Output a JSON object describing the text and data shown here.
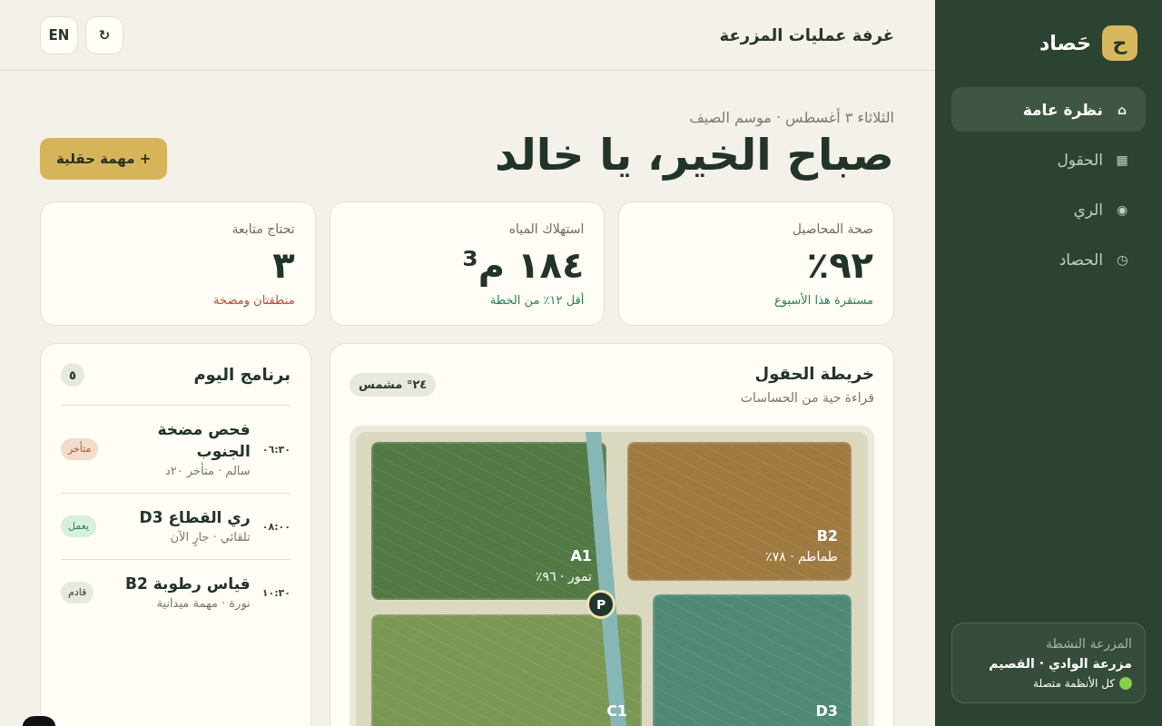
{
  "sidebar": {
    "logo": "ح",
    "brand": "حَصاد",
    "nav": [
      {
        "icon": "⌂",
        "label": "نظرة عامة",
        "selected": true
      },
      {
        "icon": "▦",
        "label": "الحقول",
        "selected": false
      },
      {
        "icon": "◉",
        "label": "الري",
        "selected": false
      },
      {
        "icon": "◷",
        "label": "الحصاد",
        "selected": false
      }
    ],
    "farm_card": {
      "label": "المزرعة النشطة",
      "name": "مزرعة الوادي · القصيم",
      "status": "كل الأنظمة متصلة",
      "online": true
    }
  },
  "header": {
    "title": "غرفة عمليات المزرعة",
    "buttons": [
      {
        "label": "↻"
      },
      {
        "label": "EN"
      }
    ]
  },
  "greeting": {
    "date": "الثلاثاء ٣ أغسطس · موسم الصيف",
    "headline": "صباح الخير، يا خالد",
    "action": "+ مهمة حقلية"
  },
  "stats": [
    {
      "label": "صحة المحاصيل",
      "value": "٩٢٪",
      "note": "مستقرة هذا الأسبوع",
      "kind": "positive"
    },
    {
      "label": "استهلاك المياه",
      "value": "١٨٤ م³",
      "note": "أقل ١٢٪ من الخطة",
      "kind": "positive"
    },
    {
      "label": "تحتاج متابعة",
      "value": "٣",
      "note": "منطقتان ومضخة",
      "kind": "negative"
    }
  ],
  "schedule": {
    "title": "برنامج اليوم",
    "count": "٥",
    "items": [
      {
        "time": "٠٦:٣٠",
        "title": "فحص مضخة الجنوب",
        "meta": "سالم · متأخر ٢٠د",
        "status": "متأخر",
        "kind": "late"
      },
      {
        "time": "٠٨:٠٠",
        "title": "ري القطاع D3",
        "meta": "تلقائي · جارٍ الآن",
        "status": "يعمل",
        "kind": "active"
      },
      {
        "time": "١٠:٣٠",
        "title": "قياس رطوبة B2",
        "meta": "نورة · مهمة ميدانية",
        "status": "قادم",
        "kind": "upcoming"
      }
    ]
  },
  "map": {
    "title": "خريطة الحقول",
    "subtitle": "قراءة حية من الحساسات",
    "weather": "٢٤° مشمس",
    "fields": [
      {
        "code": "A1",
        "crop": "تمور · ٩٦٪",
        "color": "#537a45"
      },
      {
        "code": "B2",
        "crop": "طماطم · ٧٨٪",
        "color": "#9e7a41"
      },
      {
        "code": "C1",
        "color": "#7a9854"
      },
      {
        "code": "D3",
        "color": "#4f8975"
      }
    ],
    "pump": "P"
  }
}
